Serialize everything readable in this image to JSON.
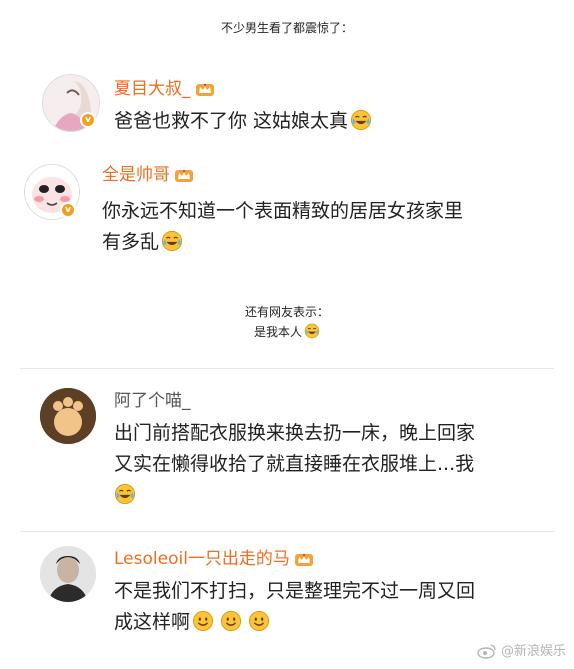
{
  "captions": {
    "top": "不少男生看了都震惊了：",
    "mid_line1": "还有网友表示：",
    "mid_line2": "是我本人"
  },
  "comments": [
    {
      "username": "夏目大叔_",
      "text": "爸爸也救不了你 这姑娘太真",
      "name_color": "orange",
      "verified": true,
      "vip_crown": true,
      "emoji": "laugh-cry-emoji"
    },
    {
      "username": "全是帅哥",
      "text_line1": "你永远不知道一个表面精致的居居女孩家里",
      "text_line2": "有多乱",
      "name_color": "orange",
      "verified": true,
      "vip_crown": true,
      "emoji": "laugh-cry-emoji"
    },
    {
      "username": "阿了个喵_",
      "text_line1": "出门前搭配衣服换来换去扔一床，晚上回家",
      "text_line2": "又实在懒得收拾了就直接睡在衣服堆上...我",
      "name_color": "gray",
      "verified": false,
      "vip_crown": false,
      "emoji": "laugh-cry-emoji"
    },
    {
      "username": "Lesoleoil一只出走的马",
      "text_line1": "不是我们不打扫，只是整理完不过一周又回",
      "text_line2": "成这样啊",
      "name_color": "orange",
      "verified": false,
      "vip_crown": true,
      "emoji": "smile-emoji"
    }
  ],
  "watermark": "@新浪娱乐",
  "colors": {
    "name_orange": "#f26d21",
    "badge": "#f0a020",
    "separator": "#e6e6e6"
  }
}
